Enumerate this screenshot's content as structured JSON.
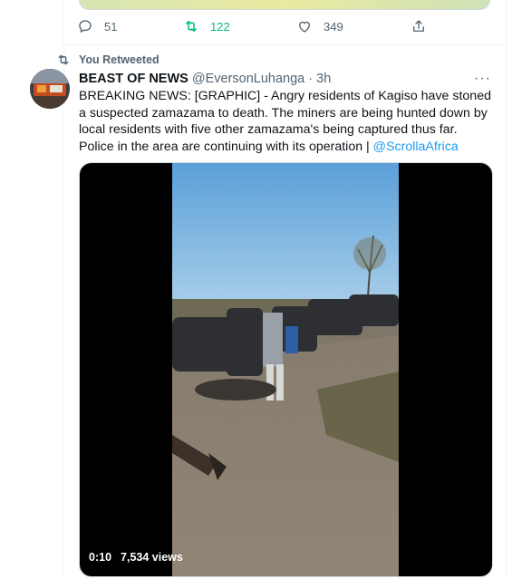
{
  "prev_tweet": {
    "reply_count": "51",
    "retweet_count": "122",
    "like_count": "349",
    "retweeted_color": "#00ba7c"
  },
  "retweet_banner": {
    "label": "You Retweeted",
    "icon": "retweet-icon"
  },
  "tweet": {
    "name": "BEAST OF NEWS",
    "handle": "@EversonLuhanga",
    "time": "· 3h",
    "more": "···",
    "text_line1": "BREAKING NEWS: [GRAPHIC] - Angry residents of Kagiso have stoned a suspected zamazama to death. The miners are being hunted down by local residents with five other zamazama's being captured thus far.",
    "text_line2_prefix": "Police in the area are continuing with its operation | ",
    "mention": "@ScrollaAfrica",
    "video": {
      "duration": "0:10",
      "views": "7,534 views"
    }
  },
  "colors": {
    "accent": "#1d9bf0",
    "muted": "#536471",
    "retweet_green": "#00ba7c"
  }
}
